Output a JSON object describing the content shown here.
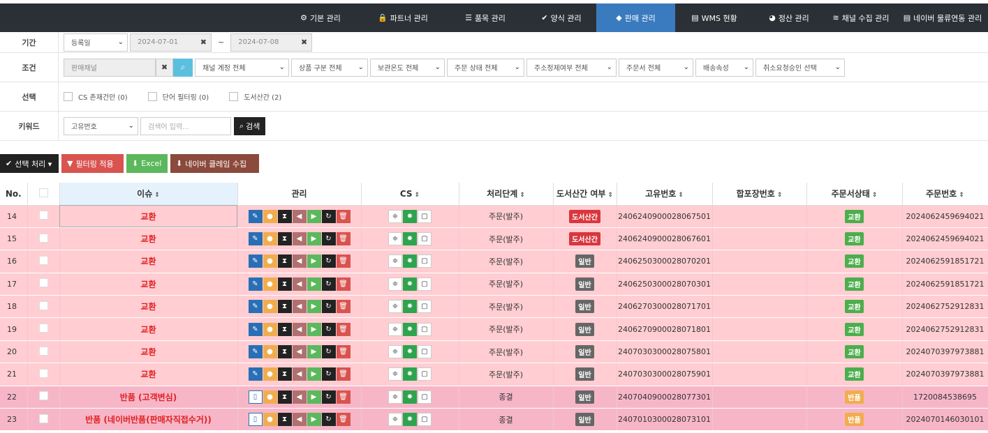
{
  "nav": {
    "items": [
      {
        "icon": "gear-icon",
        "glyph": "⚙",
        "label": "기본 관리",
        "w": 118,
        "active": false
      },
      {
        "icon": "lock-icon",
        "glyph": "🔒",
        "label": "파트너 관리",
        "w": 118,
        "active": false
      },
      {
        "icon": "list-icon",
        "glyph": "☰",
        "label": "품목 관리",
        "w": 118,
        "active": false
      },
      {
        "icon": "check-icon",
        "glyph": "✔",
        "label": "양식 관리",
        "w": 100,
        "active": false
      },
      {
        "icon": "diamond-icon",
        "glyph": "◆",
        "label": "판매 관리",
        "w": 113,
        "active": true
      },
      {
        "icon": "table-icon",
        "glyph": "▤",
        "label": "WMS 현황",
        "w": 112,
        "active": false
      },
      {
        "icon": "pie-icon",
        "glyph": "◕",
        "label": "정산 관리",
        "w": 102,
        "active": false
      },
      {
        "icon": "rss-icon",
        "glyph": "≋",
        "label": "채널 수집 관리",
        "w": 104,
        "active": false
      },
      {
        "icon": "table-icon",
        "glyph": "▤",
        "label": "네이버 물류연동 관리",
        "w": 130,
        "active": false
      }
    ]
  },
  "filters": {
    "period": {
      "label": "기간",
      "type_select": "등록일",
      "start": "2024-07-01",
      "end": "2024-07-08",
      "sep": "~"
    },
    "condition": {
      "label": "조건",
      "channel_placeholder": "판매채널",
      "selects": [
        {
          "text": "채널 계정 전체",
          "w": 135
        },
        {
          "text": "상품 구분 전체",
          "w": 110
        },
        {
          "text": "보관온도 전체",
          "w": 107
        },
        {
          "text": "주문 상태 전체",
          "w": 111
        },
        {
          "text": "주소정제여부 전체",
          "w": 129
        },
        {
          "text": "주문서 전체",
          "w": 107
        },
        {
          "text": "배송속성",
          "w": 83
        },
        {
          "text": "취소요청승인 선택",
          "w": 128
        }
      ]
    },
    "select": {
      "label": "선택",
      "checks": [
        "CS 존재건만 (0)",
        "단어 필터링 (0)",
        "도서산간 (2)"
      ]
    },
    "keyword": {
      "label": "키워드",
      "field_select": "고유번호",
      "placeholder": "검색어 입력...",
      "search_label": "검색"
    }
  },
  "actions": [
    {
      "label": "선택 처리 ▾",
      "glyph": "✔",
      "icon": "check-icon",
      "color": "#222",
      "w": 84
    },
    {
      "label": "필터링 적용",
      "glyph": "▼",
      "icon": "filter-icon",
      "color": "#d9534f",
      "w": 89
    },
    {
      "label": "Excel",
      "glyph": "⬇",
      "icon": "download-icon",
      "color": "#5cb85c",
      "w": 59
    },
    {
      "label": "네이버 클레임 수집",
      "glyph": "⬇",
      "icon": "download-icon",
      "color": "#8b4a3c",
      "w": 127
    }
  ],
  "table": {
    "headers": [
      "No.",
      "",
      "이슈",
      "관리",
      "CS",
      "처리단계",
      "도서산간 여부",
      "고유번호",
      "합포장번호",
      "주문서상태",
      "주문번호"
    ],
    "rows": [
      {
        "no": "14",
        "issue": "교환",
        "stage": "주문(발주)",
        "remote": "도서산간",
        "uid": "2406240900028067501",
        "merge": "",
        "status": "교환",
        "order": "2024062459694021",
        "tone": "r",
        "first": "pencil"
      },
      {
        "no": "15",
        "issue": "교환",
        "stage": "주문(발주)",
        "remote": "도서산간",
        "uid": "2406240900028067601",
        "merge": "",
        "status": "교환",
        "order": "2024062459694021",
        "tone": "r",
        "first": "pencil"
      },
      {
        "no": "16",
        "issue": "교환",
        "stage": "주문(발주)",
        "remote": "일반",
        "uid": "2406250300028070201",
        "merge": "",
        "status": "교환",
        "order": "2024062591851721",
        "tone": "r",
        "first": "pencil"
      },
      {
        "no": "17",
        "issue": "교환",
        "stage": "주문(발주)",
        "remote": "일반",
        "uid": "2406250300028070301",
        "merge": "",
        "status": "교환",
        "order": "2024062591851721",
        "tone": "r",
        "first": "pencil"
      },
      {
        "no": "18",
        "issue": "교환",
        "stage": "주문(발주)",
        "remote": "일반",
        "uid": "2406270300028071701",
        "merge": "",
        "status": "교환",
        "order": "2024062752912831",
        "tone": "r",
        "first": "pencil"
      },
      {
        "no": "19",
        "issue": "교환",
        "stage": "주문(발주)",
        "remote": "일반",
        "uid": "2406270900028071801",
        "merge": "",
        "status": "교환",
        "order": "2024062752912831",
        "tone": "r",
        "first": "pencil"
      },
      {
        "no": "20",
        "issue": "교환",
        "stage": "주문(발주)",
        "remote": "일반",
        "uid": "2407030300028075801",
        "merge": "",
        "status": "교환",
        "order": "2024070397973881",
        "tone": "r",
        "first": "pencil"
      },
      {
        "no": "21",
        "issue": "교환",
        "stage": "주문(발주)",
        "remote": "일반",
        "uid": "2407030300028075901",
        "merge": "",
        "status": "교환",
        "order": "2024070397973881",
        "tone": "r",
        "first": "pencil"
      },
      {
        "no": "22",
        "issue": "반품 (고객변심)",
        "stage": "종결",
        "remote": "일반",
        "uid": "2407040900028077301",
        "merge": "",
        "status": "반품",
        "order": "1720084538695",
        "tone": "p",
        "first": "file"
      },
      {
        "no": "23",
        "issue": "반품 (네이버반품(판매자직접수거))",
        "stage": "종결",
        "remote": "일반",
        "uid": "2407010300028073101",
        "merge": "",
        "status": "반품",
        "order": "2024070146030101",
        "tone": "p",
        "first": "file"
      }
    ]
  },
  "colors": {
    "nav_bg": "#2b3036",
    "nav_active": "#3a7bbf",
    "row_exchange": "#ffcdd2",
    "row_return": "#f7b6c8",
    "badge_remote": "#d9363e",
    "badge_normal": "#666666",
    "badge_exchange": "#4cae4c",
    "badge_return": "#f0ad4e"
  }
}
